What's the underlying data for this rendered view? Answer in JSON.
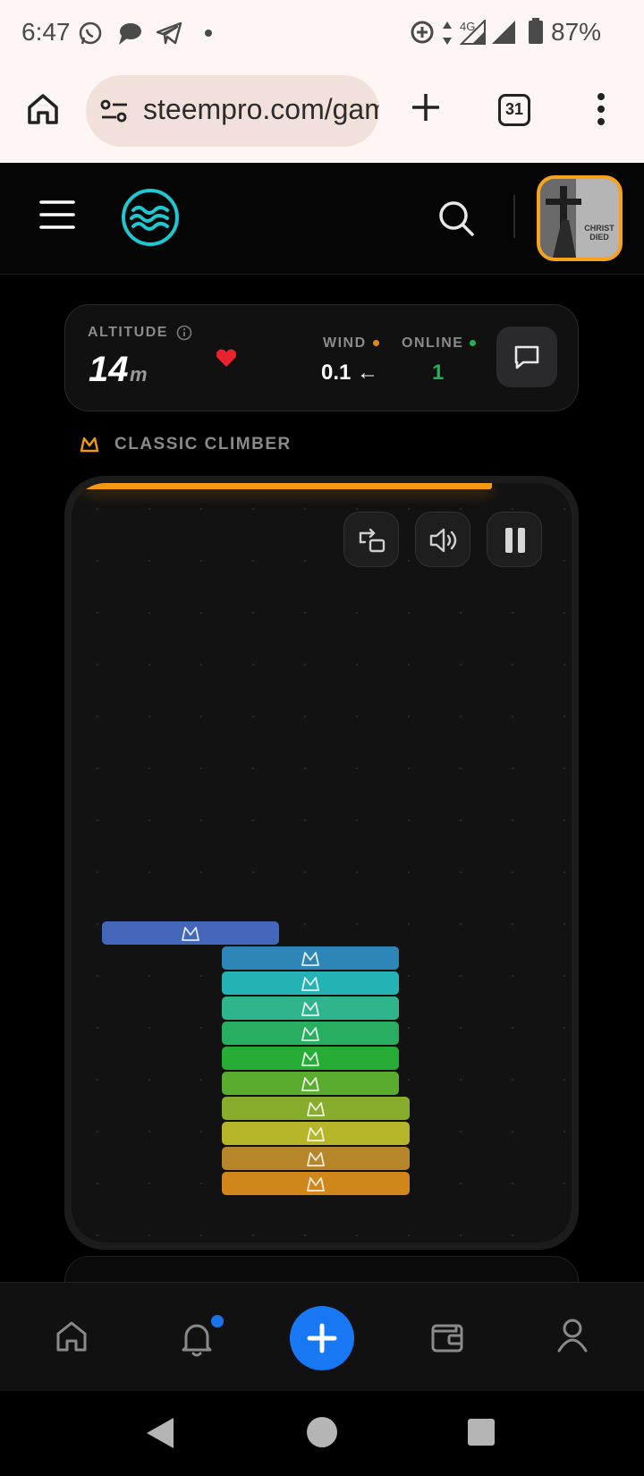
{
  "status_bar": {
    "time": "6:47",
    "network": "4G",
    "battery": "87%"
  },
  "browser": {
    "url": "steempro.com/games/climber",
    "tab_count": "31"
  },
  "header": {
    "avatar_caption": "CHRIST DIED"
  },
  "stats": {
    "altitude_label": "ALTITUDE",
    "altitude_value": "14",
    "altitude_unit": "m",
    "wind_label": "WIND",
    "wind_value": "0.1 ←",
    "online_label": "ONLINE",
    "online_value": "1"
  },
  "game": {
    "mode_title": "CLASSIC CLIMBER",
    "progress": 0.85,
    "stack_colors": [
      "#4466bb",
      "#2e86b8",
      "#24b2b5",
      "#2fb48b",
      "#28ae60",
      "#27ac35",
      "#5aac2e",
      "#88ac2c",
      "#b6b52a",
      "#b7862a",
      "#d0861a"
    ]
  },
  "colors": {
    "accent": "#f39a12",
    "brand": "#1ec8d0",
    "fab": "#1877f2",
    "like": "#e8232e",
    "online": "#1eb254"
  },
  "icons": [
    "home-icon",
    "tune-icon",
    "plus-icon",
    "menu-icon",
    "wave-logo-icon",
    "search-icon",
    "heart-icon",
    "chat-icon",
    "swap-icon",
    "volume-icon",
    "pause-icon",
    "bell-icon",
    "wallet-icon",
    "user-icon",
    "back-icon",
    "home-circle-icon",
    "recents-icon"
  ]
}
